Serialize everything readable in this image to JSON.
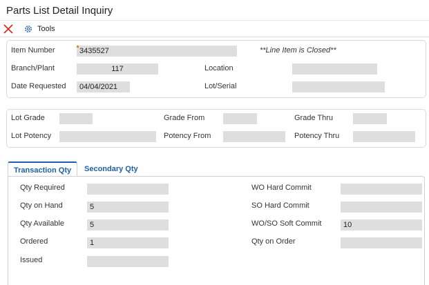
{
  "window": {
    "title": "Parts List Detail Inquiry"
  },
  "toolbar": {
    "close_icon": "close-x-icon",
    "tools_icon": "gear-icon",
    "tools_label": "Tools",
    "close_color": "#d9261c"
  },
  "header": {
    "item_number": {
      "label": "Item Number",
      "value": "3435527"
    },
    "closed_note": "**Line Item is Closed**",
    "branch_plant": {
      "label": "Branch/Plant",
      "value": "117"
    },
    "location": {
      "label": "Location",
      "value": ""
    },
    "date_requested": {
      "label": "Date Requested",
      "value": "04/04/2021"
    },
    "lot_serial": {
      "label": "Lot/Serial",
      "value": ""
    }
  },
  "grade": {
    "lot_grade": {
      "label": "Lot Grade",
      "value": ""
    },
    "grade_from": {
      "label": "Grade From",
      "value": ""
    },
    "grade_thru": {
      "label": "Grade Thru",
      "value": ""
    },
    "lot_potency": {
      "label": "Lot Potency",
      "value": ""
    },
    "potency_from": {
      "label": "Potency From",
      "value": ""
    },
    "potency_thru": {
      "label": "Potency Thru",
      "value": ""
    }
  },
  "tabs": [
    {
      "label": "Transaction Qty",
      "active": true
    },
    {
      "label": "Secondary Qty",
      "active": false
    }
  ],
  "quantities": {
    "qty_required": {
      "label": "Qty Required",
      "value": ""
    },
    "qty_on_hand": {
      "label": "Qty on Hand",
      "value": "5"
    },
    "qty_available": {
      "label": "Qty Available",
      "value": "5"
    },
    "ordered": {
      "label": "Ordered",
      "value": "1"
    },
    "issued": {
      "label": "Issued",
      "value": ""
    },
    "wo_hard_commit": {
      "label": "WO Hard Commit",
      "value": ""
    },
    "so_hard_commit": {
      "label": "SO Hard Commit",
      "value": ""
    },
    "wo_so_soft_commit": {
      "label": "WO/SO Soft Commit",
      "value": "10"
    },
    "qty_on_order": {
      "label": "Qty on Order",
      "value": ""
    }
  },
  "colors": {
    "accent": "#1f5fa8",
    "field_bg": "#dedede",
    "border": "#d9d9d9"
  }
}
